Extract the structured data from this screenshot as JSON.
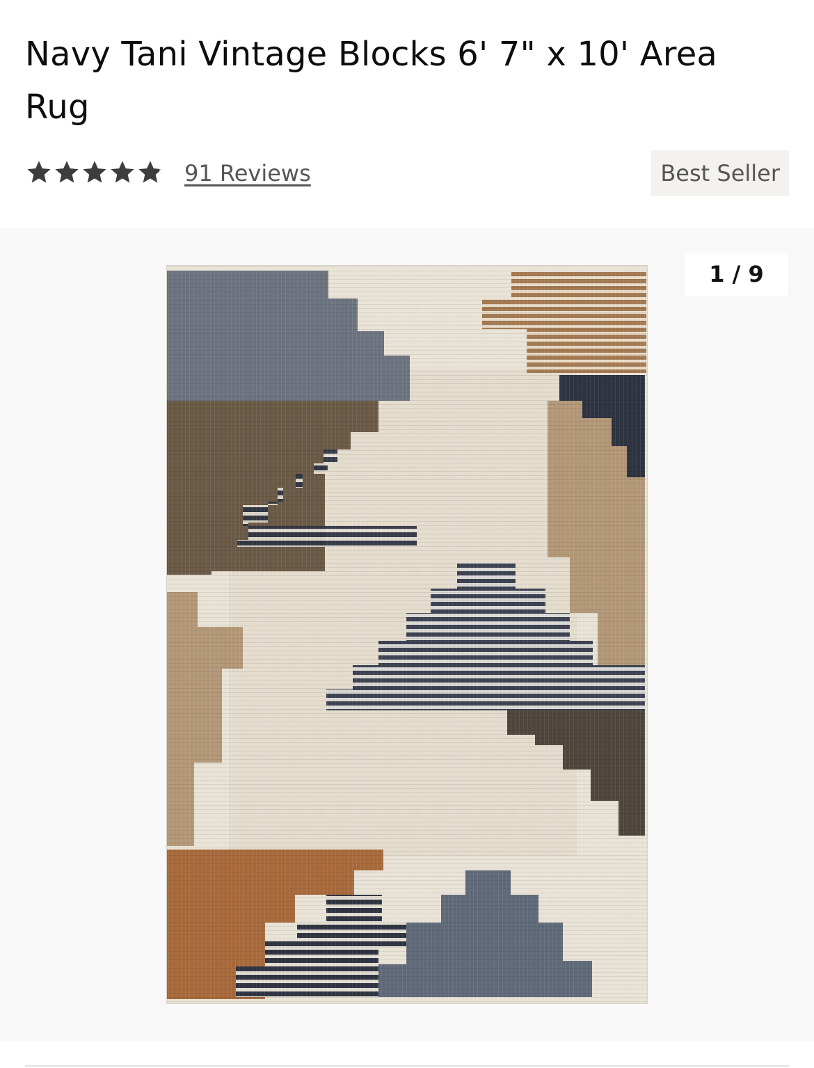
{
  "product": {
    "title": "Navy Tani Vintage Blocks 6' 7\" x 10' Area Rug",
    "rating": 4.8,
    "rating_max": 5,
    "reviews_label": "91 Reviews",
    "badge": "Best Seller"
  },
  "gallery": {
    "counter": "1 / 9",
    "image_icon": "rug-product-image"
  },
  "colors": {
    "star": "#3d3d3d",
    "badge_bg": "#f3f2ee",
    "gallery_bg": "#f8f8f8",
    "rug_cream": "#e9e3d7",
    "rug_navy": "#3b4150",
    "rug_brown": "#6b5a46",
    "rug_tan": "#b39878",
    "rug_rust": "#a86a3c",
    "rug_slate": "#6d7480"
  }
}
